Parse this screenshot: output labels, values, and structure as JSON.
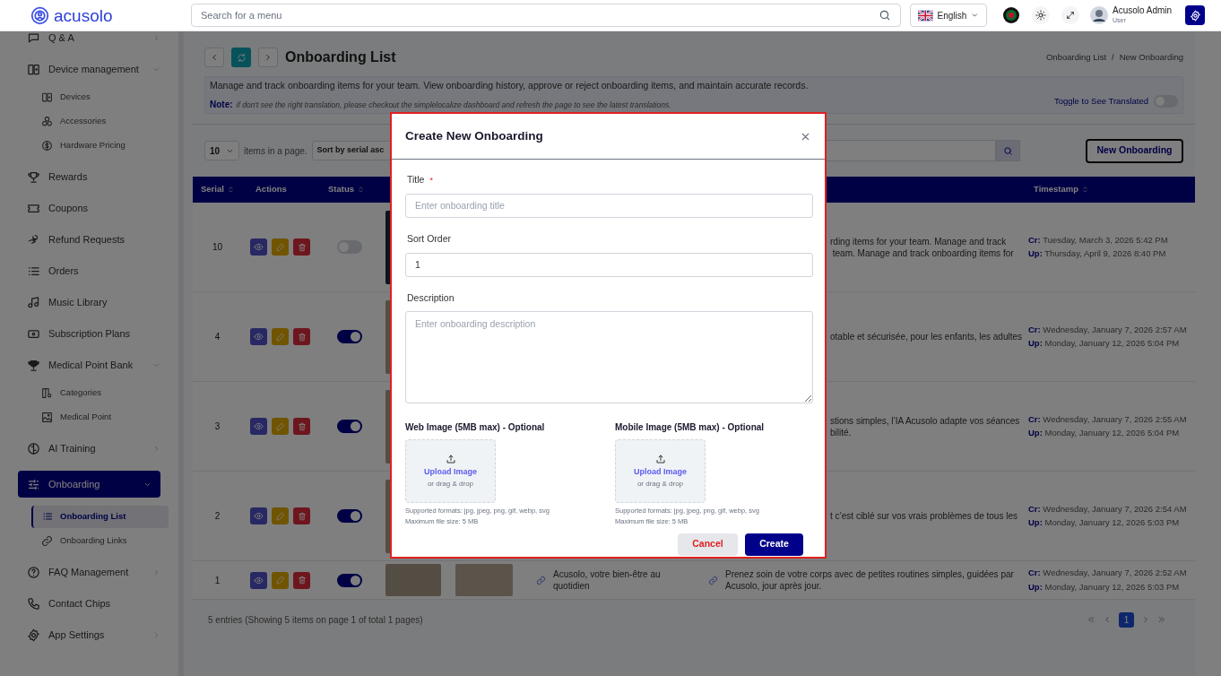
{
  "topbar": {
    "logo": "acusolo",
    "search": {
      "placeholder": "Search for a menu"
    },
    "language": "English",
    "user": {
      "name": "Acusolo Admin",
      "role": "User"
    }
  },
  "sidebar": {
    "items": [
      {
        "label": "Q & A",
        "kind": "group",
        "expanded": false,
        "selected": false
      },
      {
        "label": "Device management",
        "kind": "group",
        "expanded": true,
        "selected": false,
        "children": [
          {
            "label": "Devices",
            "selected": false
          },
          {
            "label": "Accessories",
            "selected": false
          },
          {
            "label": "Hardware Pricing",
            "selected": false
          }
        ]
      },
      {
        "label": "Rewards",
        "kind": "link",
        "selected": false
      },
      {
        "label": "Coupons",
        "kind": "link",
        "selected": false
      },
      {
        "label": "Refund Requests",
        "kind": "link",
        "selected": false
      },
      {
        "label": "Orders",
        "kind": "link",
        "selected": false
      },
      {
        "label": "Music Library",
        "kind": "link",
        "selected": false
      },
      {
        "label": "Subscription Plans",
        "kind": "link",
        "selected": false
      },
      {
        "label": "Medical Point Bank",
        "kind": "group",
        "expanded": true,
        "selected": false,
        "children": [
          {
            "label": "Categories",
            "selected": false
          },
          {
            "label": "Medical Point",
            "selected": false
          }
        ]
      },
      {
        "label": "AI Training",
        "kind": "group",
        "expanded": false,
        "selected": false
      },
      {
        "label": "Onboarding",
        "kind": "group",
        "expanded": true,
        "selected": true,
        "children": [
          {
            "label": "Onboarding List",
            "selected": true
          },
          {
            "label": "Onboarding Links",
            "selected": false
          }
        ]
      },
      {
        "label": "FAQ Management",
        "kind": "group",
        "expanded": false,
        "selected": false
      },
      {
        "label": "Contact Chips",
        "kind": "link",
        "selected": false
      },
      {
        "label": "App Settings",
        "kind": "group",
        "expanded": false,
        "selected": false
      }
    ]
  },
  "page": {
    "title": "Onboarding List",
    "breadcrumb": [
      "Onboarding List",
      "New Onboarding"
    ],
    "breadcrumb_separator": "/",
    "info": {
      "text": "Manage and track onboarding items for your team. View onboarding history, approve or reject onboarding items, and maintain accurate records.",
      "note_label": "Note:",
      "note": "if don't see the right translation, please checkout the simplelocalize dashboard and refresh the page to see the latest translations.",
      "toggle_label": "Toggle to See Translated",
      "toggle_on": false
    }
  },
  "toolbar": {
    "page_size": "10",
    "page_size_label": "items in a page.",
    "sort": "Sort by serial asc",
    "new_button": "New Onboarding"
  },
  "table": {
    "columns": [
      {
        "label": "Serial",
        "sortable": true
      },
      {
        "label": "Actions",
        "sortable": false
      },
      {
        "label": "Status",
        "sortable": true
      },
      {
        "label": "Timestamp",
        "sortable": true
      }
    ],
    "rows": [
      {
        "serial": "10",
        "active": false,
        "description": [
          "rding items for your team. Manage and track",
          " team. Manage and track onboarding items for"
        ],
        "created": "**Cr:** Tuesday, March 3, 2026 5:42 PM",
        "updated": "**Up:** Thursday, April 9, 2026 8:40 PM"
      },
      {
        "serial": "4",
        "active": true,
        "description": [
          "otable et sécurisée, pour les enfants, les adultes"
        ],
        "created": "**Cr:** Wednesday, January 7, 2026 2:57 AM",
        "updated": "**Up:** Monday, January 12, 2026 5:04 PM"
      },
      {
        "serial": "3",
        "active": true,
        "description": [
          "stions simples, l’IA Acusolo adapte vos séances",
          "bilité."
        ],
        "created": "**Cr:** Wednesday, January 7, 2026 2:55 AM",
        "updated": "**Up:** Monday, January 12, 2026 5:04 PM"
      },
      {
        "serial": "2",
        "active": true,
        "description": [
          "t c’est ciblé sur vos vrais problèmes de tous les"
        ],
        "created": "**Cr:** Wednesday, January 7, 2026 2:54 AM",
        "updated": "**Up:** Monday, January 12, 2026 5:03 PM"
      },
      {
        "serial": "1",
        "active": true,
        "title": "Acusolo, votre bien-être au quotidien",
        "description": [
          "Prenez soin de votre corps avec de petites routines simples, guidées par Acusolo, jour après jour."
        ],
        "created": "**Cr:** Wednesday, January 7, 2026 2:52 AM",
        "updated": "**Up:** Monday, January 12, 2026 5:03 PM"
      }
    ],
    "summary": "5 entries (Showing 5 items on page 1 of total 1 pages)",
    "pages": [
      {
        "label": "1",
        "selected": true
      }
    ]
  },
  "modal": {
    "title": "Create New Onboarding",
    "required_mark": "*",
    "fields": [
      {
        "kind": "input",
        "label": "Title",
        "required": true,
        "placeholder": "Enter onboarding title"
      },
      {
        "kind": "input",
        "label": "Sort Order",
        "required": false,
        "value": "1"
      },
      {
        "kind": "textarea",
        "label": "Description",
        "required": false,
        "placeholder": "Enter onboarding description"
      }
    ],
    "uploads": [
      {
        "label": "Web Image (5MB max) - Optional",
        "action": "Upload Image",
        "hint": "or drag & drop",
        "formats": "Supported formats: jpg, jpeg, png, gif, webp, svg",
        "max_size": "Maximum file size: 5 MB"
      },
      {
        "label": "Mobile Image (5MB max) - Optional",
        "action": "Upload Image",
        "hint": "or drag & drop",
        "formats": "Supported formats: jpg, jpeg, png, gif, webp, svg",
        "max_size": "Maximum file size: 5 MB"
      }
    ],
    "buttons": [
      {
        "kind": "secondary",
        "label": "Cancel"
      },
      {
        "kind": "primary",
        "label": "Create"
      }
    ]
  }
}
